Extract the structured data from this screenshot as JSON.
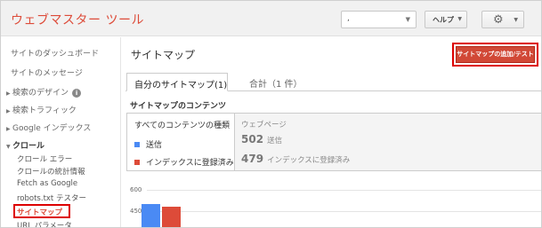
{
  "header": {
    "app_title": "ウェブマスター ツール",
    "site_selector_value": ",",
    "help_label": "ヘルプ",
    "settings_icon": "gear-icon"
  },
  "sidebar": {
    "dashboard": "サイトのダッシュボード",
    "messages": "サイトのメッセージ",
    "search_appearance": "検索のデザイン",
    "search_traffic": "検索トラフィック",
    "google_index": "Google インデックス",
    "crawl": "クロール",
    "crawl_items": [
      "クロール エラー",
      "クロールの統計情報",
      "Fetch as Google",
      "robots.txt テスター",
      "サイトマップ",
      "URL パラメータ"
    ]
  },
  "main": {
    "title": "サイトマップ",
    "add_test_button": "サイトマップの追加/テスト",
    "tabs": [
      {
        "label": "自分のサイトマップ(1)"
      },
      {
        "label": "合計（1 件）"
      }
    ],
    "section_title": "サイトマップのコンテンツ",
    "content_type": "すべてのコンテンツの種類",
    "legend": [
      {
        "label": "送信",
        "color": "#4a8af4"
      },
      {
        "label": "インデックスに登録済み",
        "color": "#dd4b39"
      }
    ],
    "stats_header": "ウェブページ",
    "stats": [
      {
        "value": "502",
        "label": "送信"
      },
      {
        "value": "479",
        "label": "インデックスに登録済み"
      }
    ]
  },
  "chart_data": {
    "type": "bar",
    "categories": [
      ""
    ],
    "series": [
      {
        "name": "送信",
        "values": [
          502
        ],
        "color": "#4a8af4"
      },
      {
        "name": "インデックスに登録済み",
        "values": [
          479
        ],
        "color": "#dd4b39"
      }
    ],
    "y_ticks": [
      "600",
      "450"
    ],
    "ylim": [
      450,
      600
    ]
  }
}
